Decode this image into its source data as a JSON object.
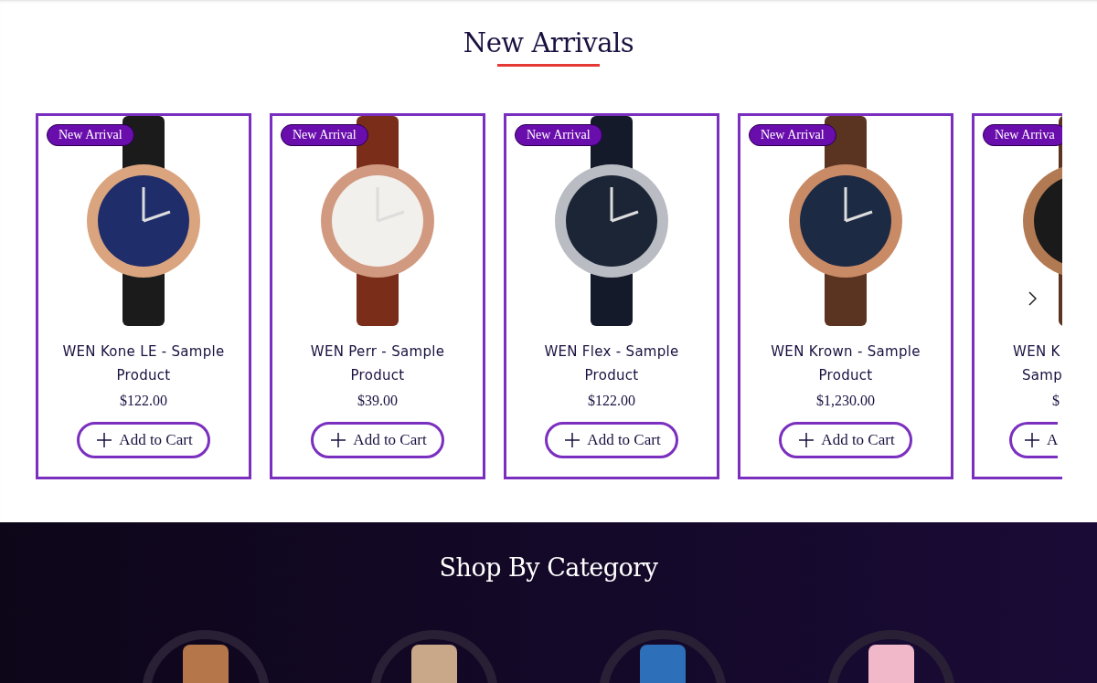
{
  "new_arrivals": {
    "title": "New Arrivals",
    "products": [
      {
        "kind": "full",
        "badge": "New Arrival",
        "name": "WEN Kone LE - Sample Product",
        "price": "$122.00",
        "button": "Add to Cart"
      },
      {
        "kind": "full",
        "badge": "New Arrival",
        "name": "WEN Perr - Sample Product",
        "price": "$39.00",
        "button": "Add to Cart"
      },
      {
        "kind": "full",
        "badge": "New Arrival",
        "name": "WEN Flex - Sample Product",
        "price": "$122.00",
        "button": "Add to Cart"
      },
      {
        "kind": "full",
        "badge": "New Arrival",
        "name": "WEN Krown - Sample Product",
        "price": "$1,230.00",
        "button": "Add to Cart"
      },
      {
        "kind": "partial",
        "badge": "New Arriva",
        "name": "WEN K",
        "name_line_2": "Samp",
        "price": "$",
        "button": "A"
      }
    ]
  },
  "shop_by_category": {
    "title": "Shop By Category"
  }
}
